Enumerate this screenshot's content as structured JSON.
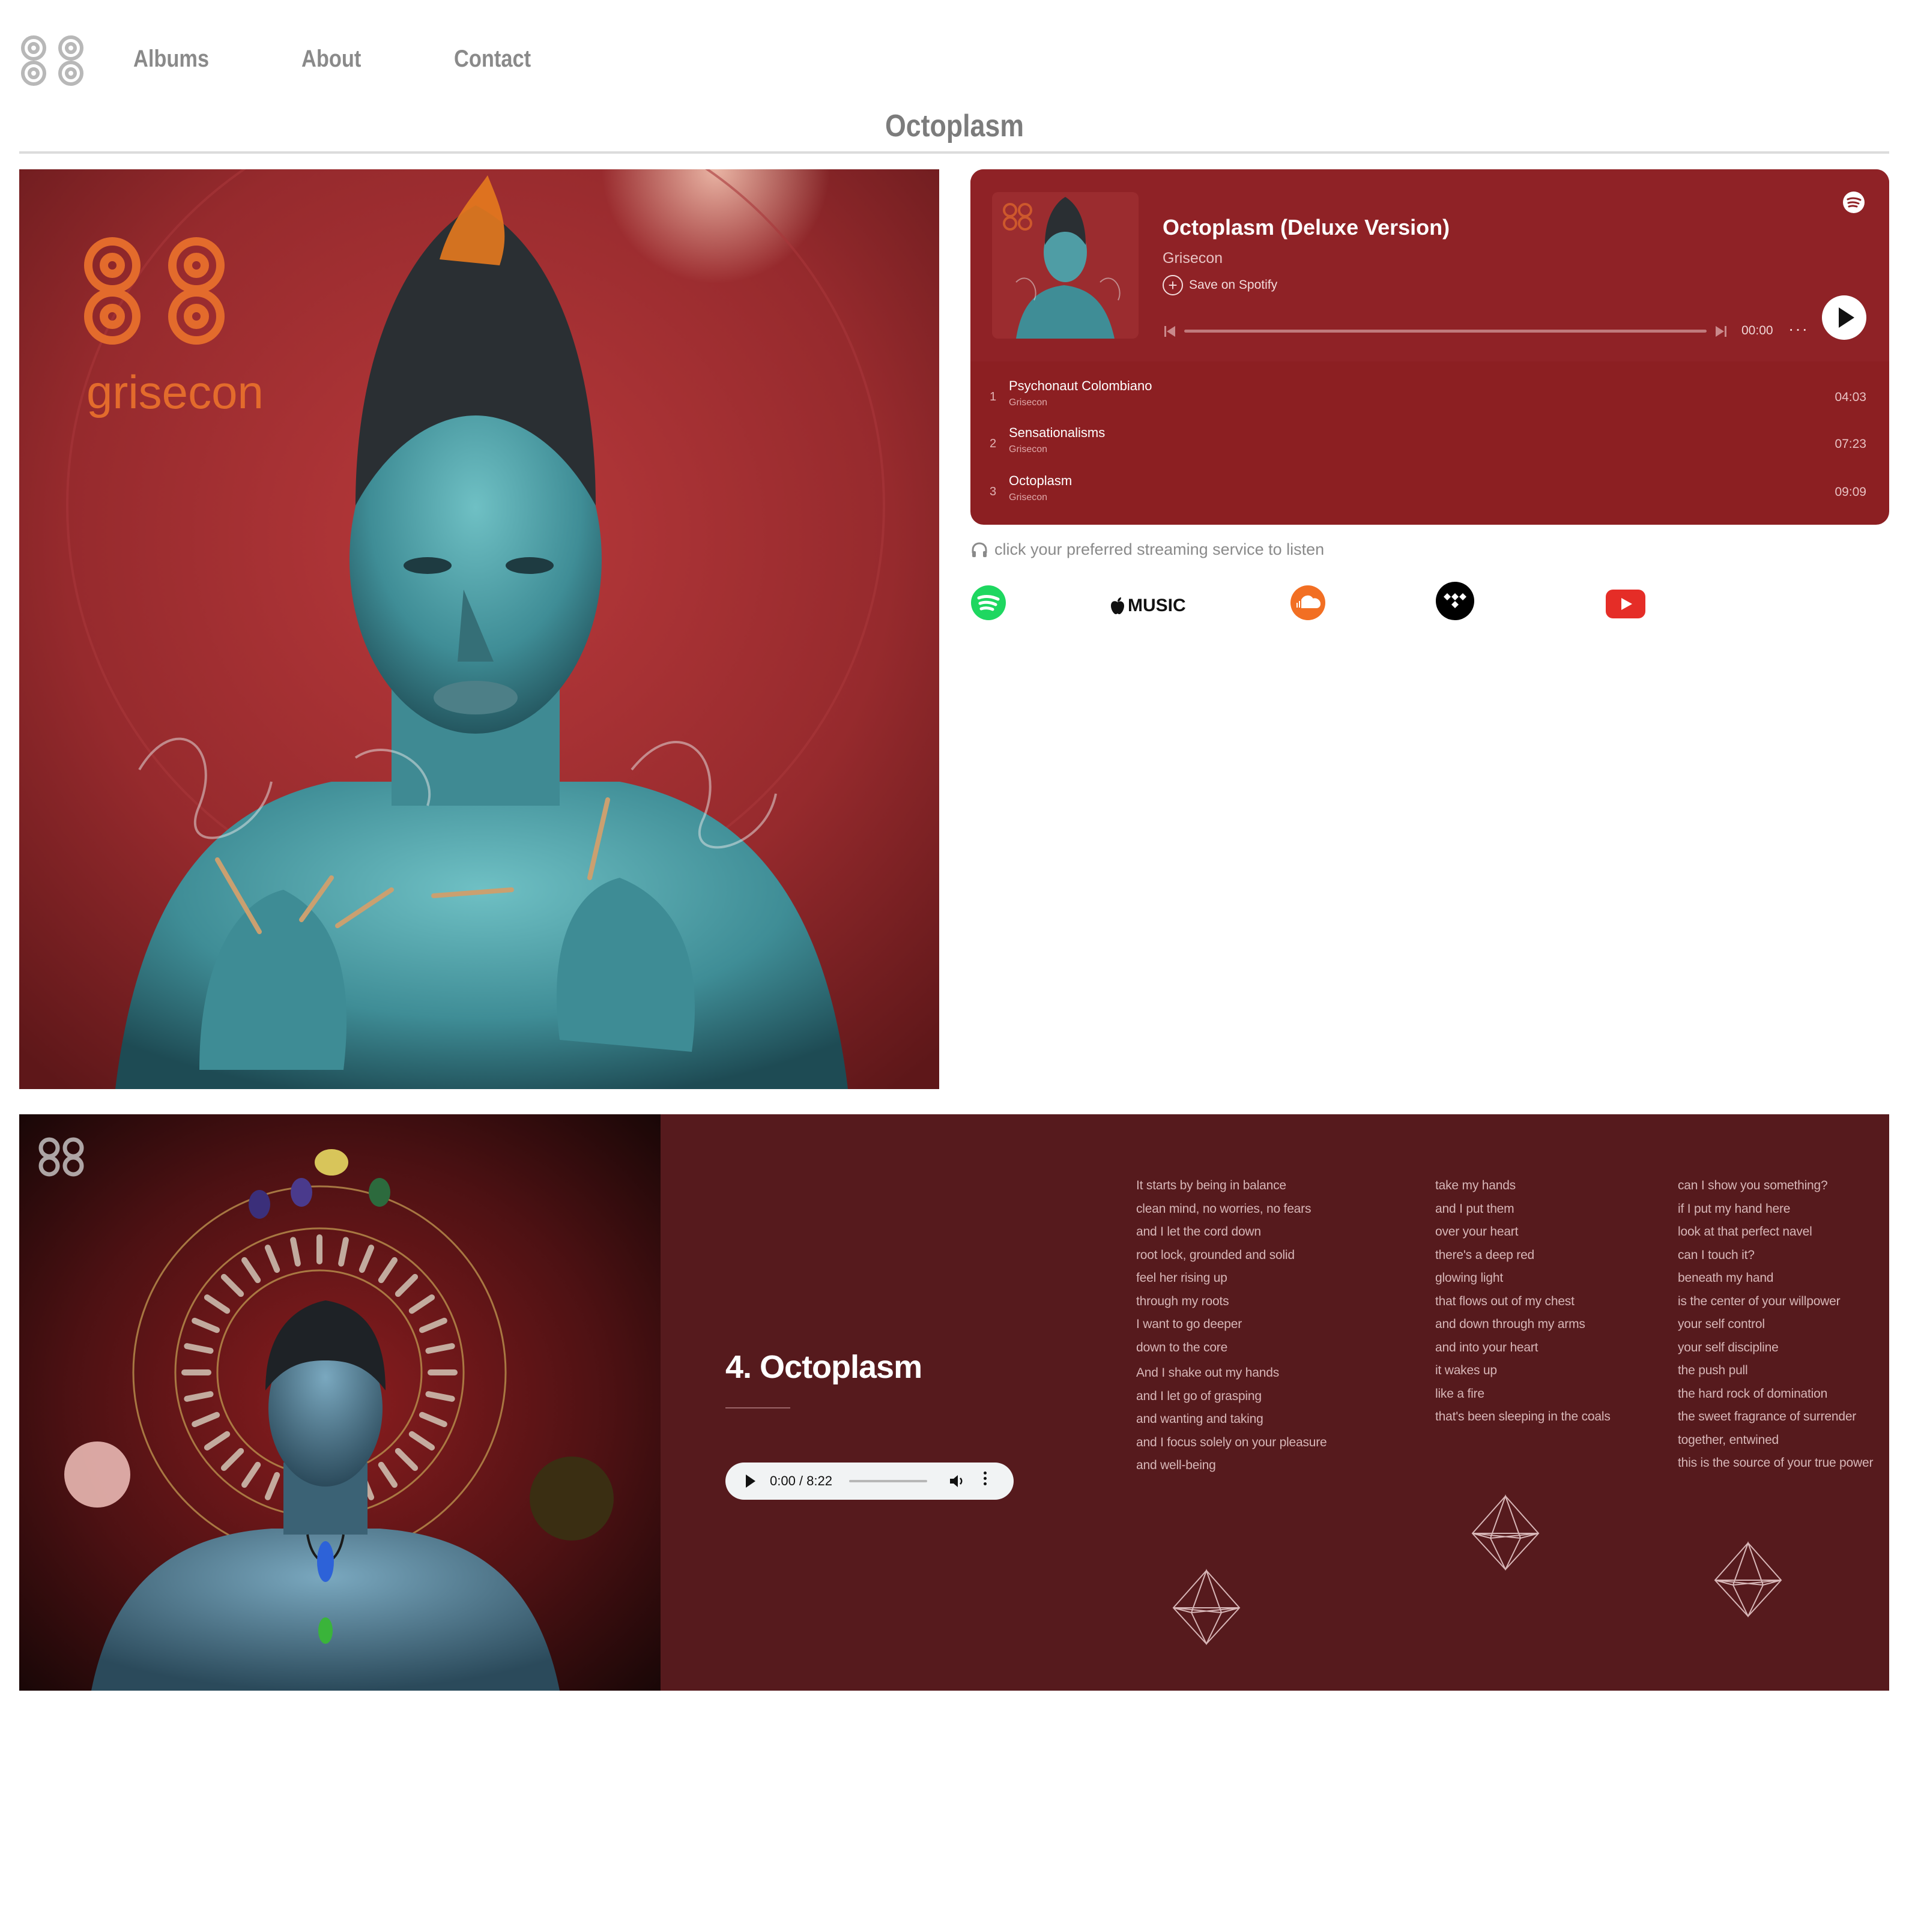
{
  "nav": {
    "logo_alt": "grisecon logo",
    "links": [
      {
        "label": "Albums"
      },
      {
        "label": "About"
      },
      {
        "label": "Contact"
      }
    ]
  },
  "page": {
    "title": "Octoplasm"
  },
  "cover": {
    "brand_text": "grisecon"
  },
  "spotify": {
    "album_title": "Octoplasm (Deluxe Version)",
    "artist": "Grisecon",
    "save_label": "Save on Spotify",
    "time": "00:00",
    "more": "···",
    "tracks": [
      {
        "num": "1",
        "name": "Psychonaut Colombiano",
        "artist": "Grisecon",
        "duration": "04:03"
      },
      {
        "num": "2",
        "name": "Sensationalisms",
        "artist": "Grisecon",
        "duration": "07:23"
      },
      {
        "num": "3",
        "name": "Octoplasm",
        "artist": "Grisecon",
        "duration": "09:09"
      }
    ]
  },
  "streaming": {
    "note": "click your preferred streaming service to listen",
    "services": [
      {
        "name": "Spotify",
        "icon": "spotify-icon"
      },
      {
        "name": "Apple Music",
        "label": "MUSIC",
        "icon": "apple-icon"
      },
      {
        "name": "SoundCloud",
        "icon": "soundcloud-icon"
      },
      {
        "name": "Tidal",
        "icon": "tidal-icon"
      },
      {
        "name": "YouTube",
        "icon": "youtube-icon"
      }
    ],
    "colors": {
      "spotify": "#1ed760",
      "soundcloud": "#f26f23",
      "tidal": "#000000",
      "youtube": "#e52d27"
    }
  },
  "track": {
    "title": "4. Octoplasm",
    "audio_time": "0:00 / 8:22",
    "lyrics": {
      "col1": [
        "It starts by being in balance",
        "clean mind, no worries, no fears",
        "and I let the cord down",
        "root lock, grounded and solid",
        "feel her rising  up",
        "through my roots",
        "I want to go deeper",
        "down to the core",
        "",
        "And I shake out my hands",
        "and I let go of grasping",
        "and wanting and taking",
        "and I focus solely on your pleasure",
        "and well-being"
      ],
      "col2": [
        "take my hands",
        "and I put them",
        "over your heart",
        "there's a deep red",
        "glowing light",
        "that flows out of my chest",
        "and down through my arms",
        "and into your heart",
        "it wakes up",
        "like a fire",
        "that's been sleeping in the coals"
      ],
      "col3": [
        "can I show you something?",
        "if I put my hand here",
        "look at that perfect navel",
        "can I touch it?",
        "beneath my hand",
        "is the center of your willpower",
        "your self control",
        "your self discipline",
        "the push pull",
        "the hard rock of domination",
        "the sweet fragrance of surrender",
        "together, entwined",
        "this is the source of your true power"
      ]
    }
  },
  "colors": {
    "spotify_embed_bg": "#8c1f22",
    "track_section_bg": "#561a1d",
    "nav_text": "#8a8a8a"
  }
}
